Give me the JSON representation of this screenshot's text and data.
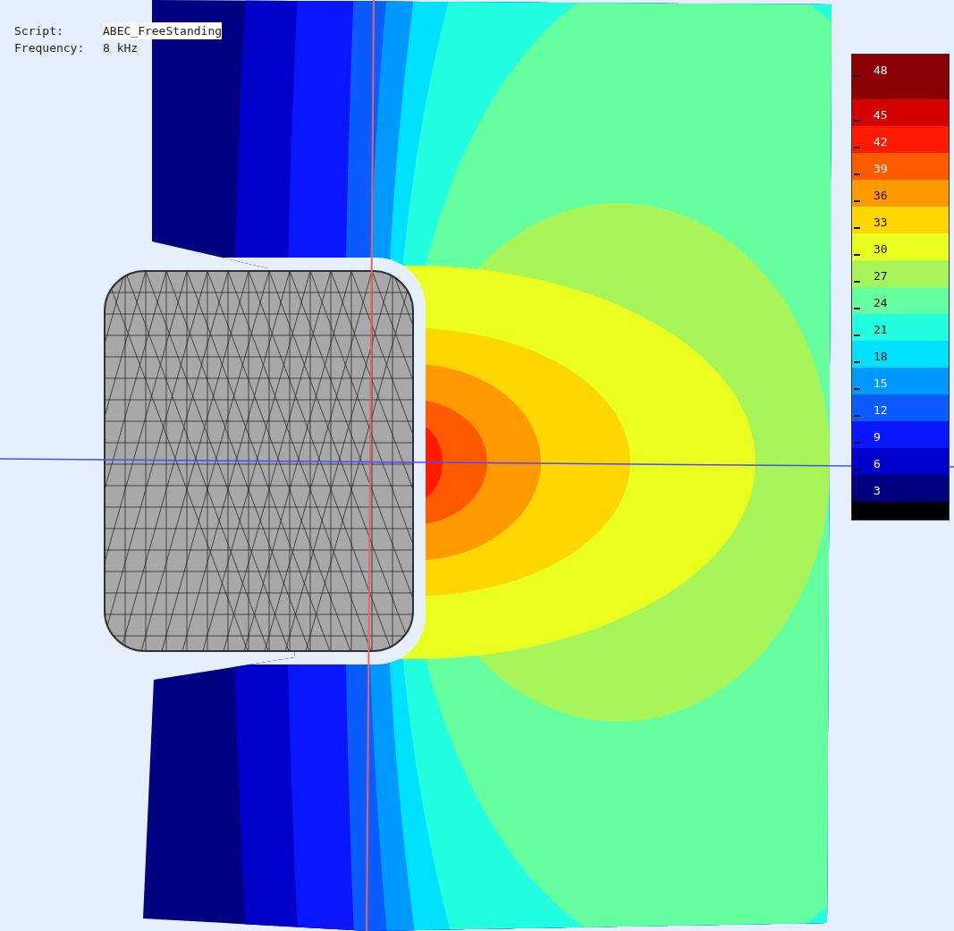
{
  "info": [
    {
      "label": "Script:",
      "value": "ABEC_FreeStanding",
      "highlighted": true
    },
    {
      "label": "Frequency:",
      "value": "8 kHz",
      "highlighted": false
    }
  ],
  "legend": {
    "bands": [
      {
        "label": "48",
        "color": "#8b0000"
      },
      {
        "label": "45",
        "color": "#d40000"
      },
      {
        "label": "42",
        "color": "#ff1a00"
      },
      {
        "label": "39",
        "color": "#ff5a00"
      },
      {
        "label": "36",
        "color": "#ff9900"
      },
      {
        "label": "33",
        "color": "#ffd700"
      },
      {
        "label": "30",
        "color": "#eaff1f"
      },
      {
        "label": "27",
        "color": "#a8f55a"
      },
      {
        "label": "24",
        "color": "#66ffa0"
      },
      {
        "label": "21",
        "color": "#22ffe0"
      },
      {
        "label": "18",
        "color": "#00e0ff"
      },
      {
        "label": "15",
        "color": "#0099ff"
      },
      {
        "label": "12",
        "color": "#0a5cff"
      },
      {
        "label": "9",
        "color": "#0a16ff"
      },
      {
        "label": "6",
        "color": "#0000c8"
      },
      {
        "label": "3",
        "color": "#000080"
      },
      {
        "color": "#000000"
      }
    ]
  }
}
